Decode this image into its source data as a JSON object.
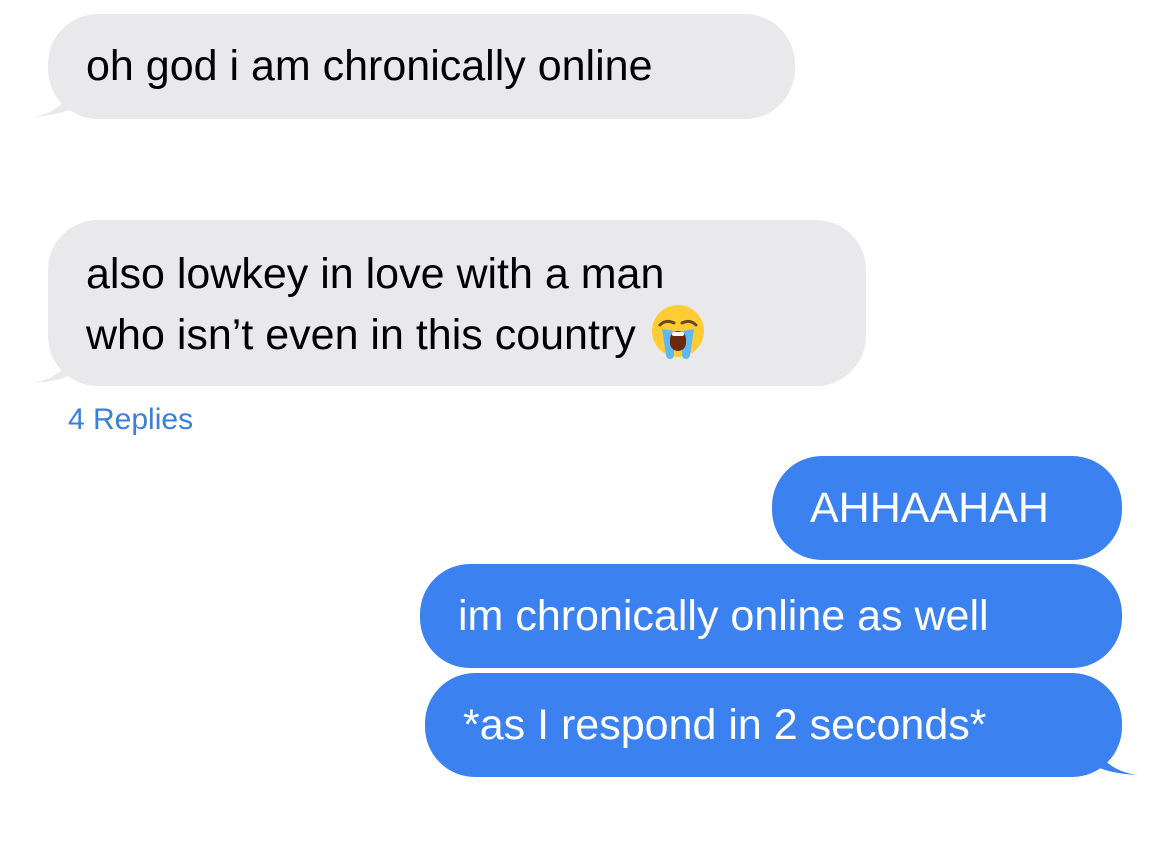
{
  "colors": {
    "received_bubble": "#e9e9eb",
    "sent_bubble": "#3b82f0",
    "replies_link": "#3b7fdc"
  },
  "messages": [
    {
      "direction": "received",
      "lines": [
        "oh god i am chronically online"
      ]
    },
    {
      "direction": "received",
      "lines": [
        "also lowkey in love with a man",
        "who isn’t even in this country"
      ],
      "emoji": "loudly-crying-face-icon"
    },
    {
      "direction": "sent",
      "lines": [
        "AHHAAHAH"
      ]
    },
    {
      "direction": "sent",
      "lines": [
        "im chronically online as well"
      ]
    },
    {
      "direction": "sent",
      "lines": [
        "*as I respond in 2 seconds*"
      ]
    }
  ],
  "thread": {
    "replies_label": "4 Replies"
  }
}
